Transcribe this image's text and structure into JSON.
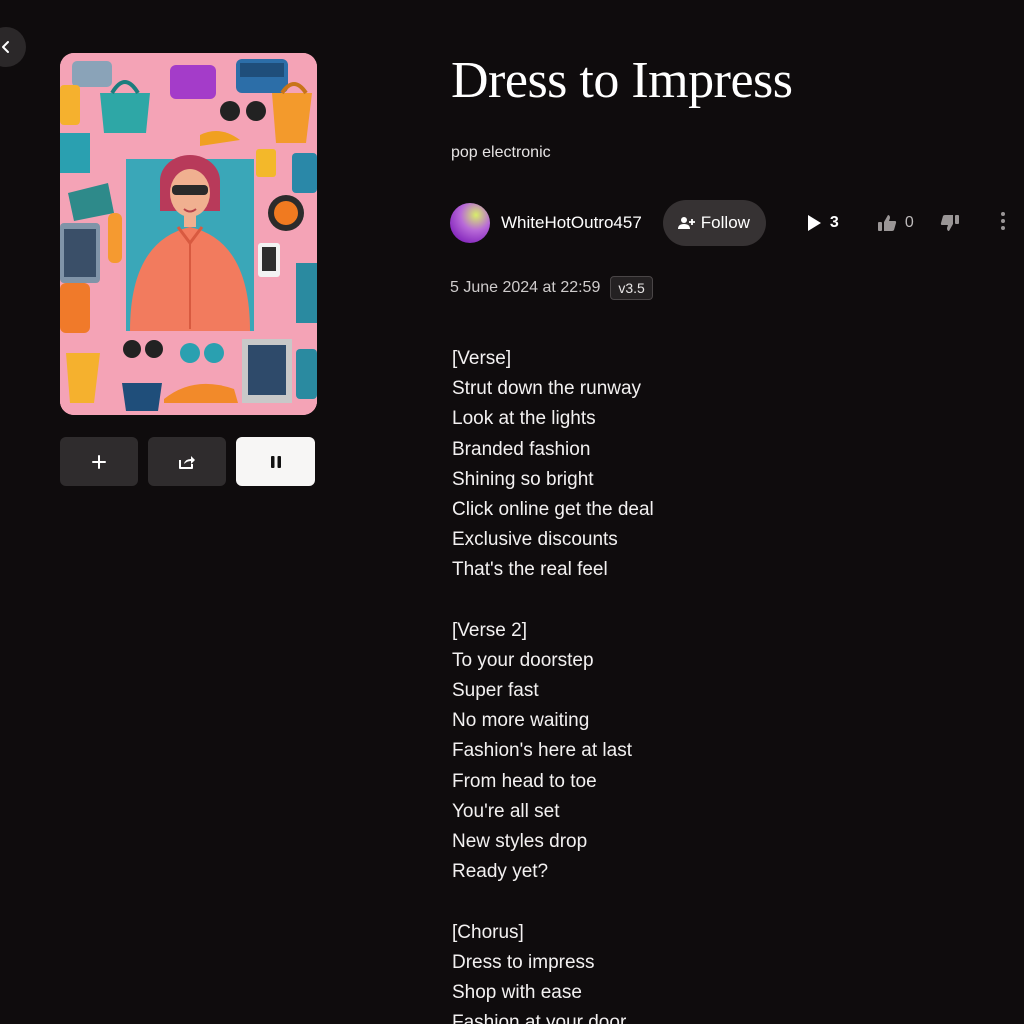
{
  "song": {
    "title": "Dress to Impress",
    "genre": "pop electronic",
    "date": "5 June 2024 at 22:59",
    "version": "v3.5"
  },
  "creator": {
    "username": "WhiteHotOutro457",
    "follow_label": "Follow"
  },
  "stats": {
    "plays": "3",
    "likes": "0"
  },
  "icons": {
    "back": "chevron-left-icon",
    "add": "plus-icon",
    "share": "share-icon",
    "playback": "pause-icon",
    "follow": "add-user-icon",
    "plays": "play-icon",
    "like": "thumbs-up-icon",
    "dislike": "thumbs-down-icon",
    "more": "more-vertical-icon"
  },
  "colors": {
    "background": "#0f0c0d",
    "button": "#2f2c2d",
    "play_button": "#f7f6f5",
    "cover_background": "#f3a3b5"
  },
  "lyrics": [
    "[Verse]",
    "Strut down the runway",
    "Look at the lights",
    "Branded fashion",
    "Shining so bright",
    "Click online get the deal",
    "Exclusive discounts",
    "That's the real feel",
    "",
    "[Verse 2]",
    "To your doorstep",
    "Super fast",
    "No more waiting",
    "Fashion's here at last",
    "From head to toe",
    "You're all set",
    "New styles drop",
    "Ready yet?",
    "",
    "[Chorus]",
    "Dress to impress",
    "Shop with ease",
    "Fashion at your door"
  ]
}
